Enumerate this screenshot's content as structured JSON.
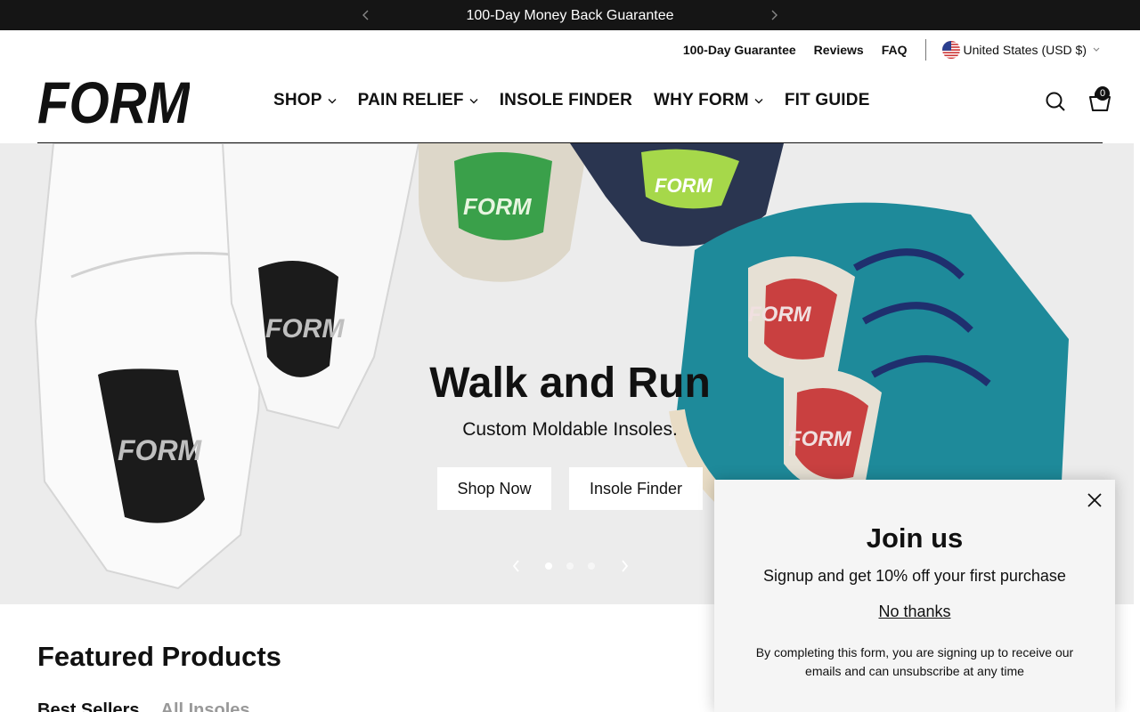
{
  "announcement": {
    "message": "100-Day Money Back Guarantee",
    "prev_icon": "chevron-left-icon",
    "next_icon": "chevron-right-icon"
  },
  "utility": {
    "links": [
      "100-Day Guarantee",
      "Reviews",
      "FAQ"
    ],
    "country": "United States (USD $)",
    "country_icon": "us-flag-icon"
  },
  "header": {
    "logo_text": "FORM",
    "nav": [
      "SHOP",
      "PAIN RELIEF",
      "INSOLE FINDER",
      "WHY FORM",
      "FIT GUIDE"
    ],
    "cart_count": "0"
  },
  "hero": {
    "title": "Walk and Run",
    "subtitle": "Custom Moldable Insoles.",
    "buttons": [
      "Shop Now",
      "Insole Finder"
    ],
    "insole_label": "FORM",
    "active_slide": 1,
    "slide_count": 3
  },
  "featured": {
    "title": "Featured Products",
    "tabs": [
      "Best Sellers",
      "All Insoles"
    ]
  },
  "popup": {
    "title": "Join us",
    "subtitle": "Signup and get 10% off your first purchase",
    "dismiss": "No thanks",
    "fine_print": "By completing this form, you are signing up to receive our emails and can unsubscribe at any time"
  },
  "colors": {
    "dark": "#151515",
    "teal_shoe": "#1e8a9a",
    "navy_lace": "#1f2f6e",
    "green_insole": "#3aa04a"
  }
}
